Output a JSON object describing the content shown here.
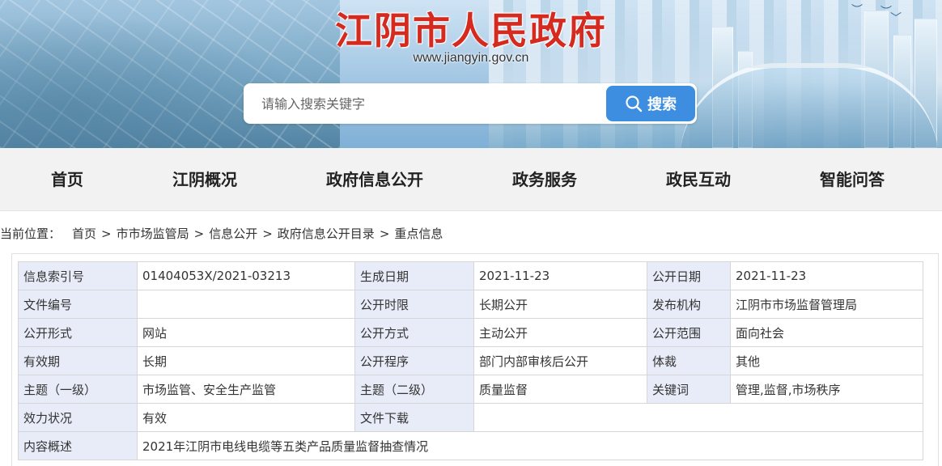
{
  "header": {
    "site_title": "江阴市人民政府",
    "site_url": "www.jiangyin.gov.cn",
    "search": {
      "placeholder": "请输入搜索关键字",
      "button_label": "搜索"
    }
  },
  "nav": {
    "items": [
      {
        "label": "首页"
      },
      {
        "label": "江阴概况"
      },
      {
        "label": "政府信息公开"
      },
      {
        "label": "政务服务"
      },
      {
        "label": "政民互动"
      },
      {
        "label": "智能问答"
      }
    ]
  },
  "breadcrumb": {
    "prefix": "当前位置：",
    "items": [
      "首页",
      "市市场监管局",
      "信息公开",
      "政府信息公开目录",
      "重点信息"
    ],
    "separator": ">"
  },
  "info": {
    "rows": [
      {
        "k1": "信息索引号",
        "v1": "01404053X/2021-03213",
        "k2": "生成日期",
        "v2": "2021-11-23",
        "k3": "公开日期",
        "v3": "2021-11-23"
      },
      {
        "k1": "文件编号",
        "v1": "",
        "k2": "公开时限",
        "v2": "长期公开",
        "k3": "发布机构",
        "v3": "江阴市市场监督管理局"
      },
      {
        "k1": "公开形式",
        "v1": "网站",
        "k2": "公开方式",
        "v2": "主动公开",
        "k3": "公开范围",
        "v3": "面向社会"
      },
      {
        "k1": "有效期",
        "v1": "长期",
        "k2": "公开程序",
        "v2": "部门内部审核后公开",
        "k3": "体裁",
        "v3": "其他"
      },
      {
        "k1": "主题（一级）",
        "v1": "市场监管、安全生产监管",
        "k2": "主题（二级）",
        "v2": "质量监督",
        "k3": "关键词",
        "v3": "管理,监督,市场秩序"
      }
    ],
    "validity": {
      "key": "效力状况",
      "value": "有效",
      "download_key": "文件下载",
      "download_value": ""
    },
    "summary": {
      "key": "内容概述",
      "value": "2021年江阴市电线电缆等五类产品质量监督抽查情况"
    }
  },
  "colors": {
    "title_red": "#d42a1f",
    "search_button_blue": "#3d8ee0",
    "nav_bg": "#f2f2f2",
    "table_key_bg": "#e8ecf8"
  }
}
